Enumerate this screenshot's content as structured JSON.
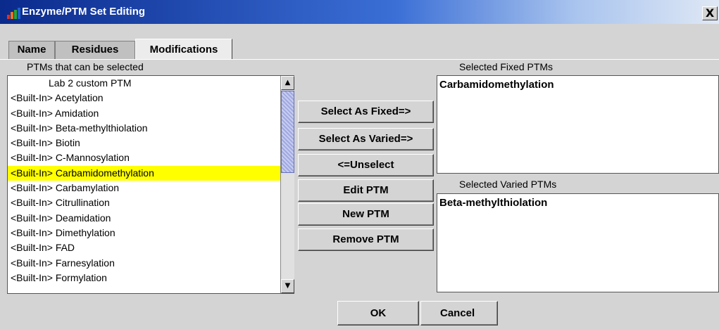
{
  "window": {
    "title": "Enzyme/PTM Set Editing",
    "close_label": "X"
  },
  "tabs": [
    {
      "label": "Name",
      "active": false
    },
    {
      "label": "Residues",
      "active": false
    },
    {
      "label": "Modifications",
      "active": true
    }
  ],
  "available": {
    "label": "PTMs that can be selected",
    "items": [
      "Lab 2 custom PTM",
      "<Built-In> Acetylation",
      "<Built-In> Amidation",
      "<Built-In> Beta-methylthiolation",
      "<Built-In> Biotin",
      "<Built-In> C-Mannosylation",
      "<Built-In> Carbamidomethylation",
      "<Built-In> Carbamylation",
      "<Built-In> Citrullination",
      "<Built-In> Deamidation",
      "<Built-In> Dimethylation",
      "<Built-In> FAD",
      "<Built-In> Farnesylation",
      "<Built-In> Formylation"
    ],
    "selected_item": "<Built-In> Carbamidomethylation"
  },
  "actions": {
    "select_fixed": "Select As Fixed=>",
    "select_varied": "Select As Varied=>",
    "unselect": "<=Unselect",
    "edit": "Edit PTM",
    "new": "New PTM",
    "remove": "Remove PTM"
  },
  "fixed": {
    "label": "Selected Fixed PTMs",
    "value": "Carbamidomethylation"
  },
  "varied": {
    "label": "Selected Varied PTMs",
    "value": "Beta-methylthiolation"
  },
  "footer": {
    "ok": "OK",
    "cancel": "Cancel"
  },
  "colors": {
    "selection": "#ffff00",
    "title_bar": "#0a2a8c"
  }
}
